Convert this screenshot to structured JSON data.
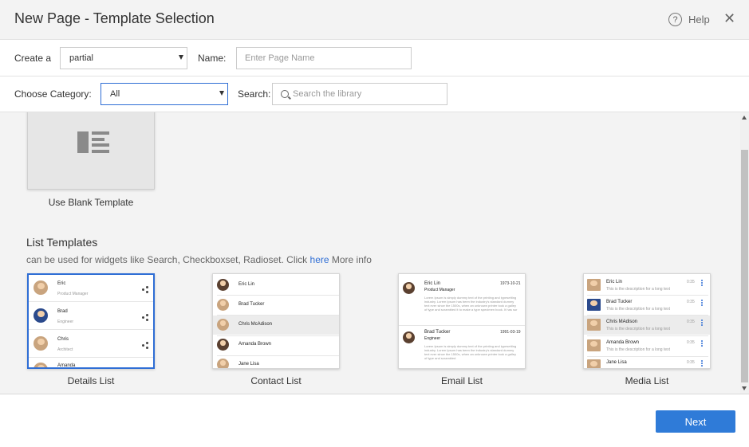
{
  "header": {
    "title": "New Page - Template Selection",
    "help_label": "Help",
    "help_glyph": "?",
    "close_glyph": "✕"
  },
  "form": {
    "create_label": "Create a",
    "create_value": "partial",
    "name_label": "Name:",
    "name_placeholder": "Enter Page Name",
    "category_label": "Choose Category:",
    "category_value": "All",
    "search_label": "Search:",
    "search_placeholder": "Search the library"
  },
  "blank": {
    "label": "Use Blank Template"
  },
  "list_section": {
    "title": "List Templates",
    "desc_before": "can be used for widgets like Search, Checkboxset, Radioset. Click ",
    "desc_link": "here",
    "desc_after": " More info"
  },
  "templates": [
    {
      "label": "Details List",
      "selected": true
    },
    {
      "label": "Contact List",
      "selected": false
    },
    {
      "label": "Email List",
      "selected": false
    },
    {
      "label": "Media List",
      "selected": false
    }
  ],
  "previews": {
    "details": [
      {
        "name": "Eric",
        "role": "Product Manager"
      },
      {
        "name": "Brad",
        "role": "Engineer"
      },
      {
        "name": "Chris",
        "role": "Architect"
      },
      {
        "name": "Amanda",
        "role": ""
      }
    ],
    "contact": [
      "Eric Lin",
      "Brad Tucker",
      "Chris McAdison",
      "Amanda Brown",
      "Jane Lisa"
    ],
    "email": [
      {
        "name": "Eric Lin",
        "role": "Product Manager",
        "date": "1973-10-21",
        "body": "Lorem Ipsum is simply dummy text of the printing and typesetting industry. Lorem Ipsum has been the industry's standard dummy text ever since the 1500s, when an unknown printer took a galley of type and scrambled it to make a type specimen book. It has sur"
      },
      {
        "name": "Brad Tucker",
        "role": "Engineer",
        "date": "1991-03-19",
        "body": "Lorem Ipsum is simply dummy text of the printing and typesetting industry. Lorem Ipsum has been the industry's standard dummy text ever since the 1500s, when an unknown printer took a galley of type and scrambled"
      }
    ],
    "media": [
      {
        "name": "Eric Lin",
        "desc": "This is the description for a long text",
        "time": "0:35"
      },
      {
        "name": "Brad Tucker",
        "desc": "This is the description for a long text",
        "time": "0:35"
      },
      {
        "name": "Chris MAdison",
        "desc": "This is the description for a long text",
        "time": "0:35"
      },
      {
        "name": "Amanda Brown",
        "desc": "This is the description for a long text",
        "time": "0:35"
      },
      {
        "name": "Jane Lisa",
        "desc": "",
        "time": "0:35"
      }
    ]
  },
  "footer": {
    "next_label": "Next"
  },
  "colors": {
    "accent": "#2f7bd8",
    "link": "#2f6ed5",
    "header_bg": "#f3f3f3"
  }
}
